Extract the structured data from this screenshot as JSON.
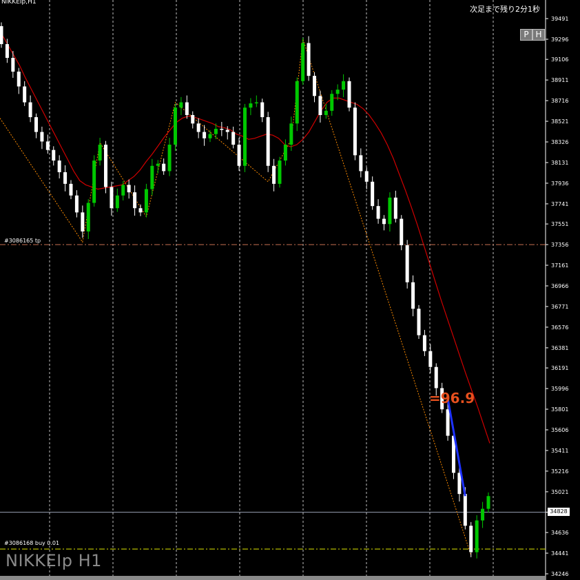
{
  "header": {
    "symbol_label": "NIKKEIp,H1",
    "countdown_text": "次足まで残り2分1秒",
    "p_button": "P",
    "h_button": "H"
  },
  "watermark": "NIKKEIp H1",
  "overlay_value": "=96.9",
  "orders": {
    "tp_label": "#3086165 tp",
    "buy_label": "#3086168 buy 0.01"
  },
  "current_price": "34828",
  "colors": {
    "background": "#000000",
    "bull_candle": "#00c800",
    "bear_candle": "#ffffff",
    "moving_average": "#d00000",
    "zigzag": "#ff8c00",
    "grid": "#c0c0c0",
    "tp_line": "#c87050",
    "buy_line": "#c8d000",
    "overlay_value": "#e6501e",
    "trade_line": "#1e32ff"
  },
  "chart_data": {
    "type": "candlestick",
    "y_ticks": [
      "39491",
      "39296",
      "39106",
      "38911",
      "38716",
      "38521",
      "38326",
      "38131",
      "37936",
      "37741",
      "37551",
      "37356",
      "37161",
      "36966",
      "36771",
      "36576",
      "36381",
      "36191",
      "35996",
      "35801",
      "35606",
      "35411",
      "35216",
      "35021",
      "34828",
      "34636",
      "34441",
      "34246"
    ],
    "y_range": [
      34246,
      39491
    ],
    "grid": true,
    "tp_price": 37356,
    "buy_price": 34480,
    "current_price": 34828,
    "closes": [
      39250,
      39120,
      38990,
      38850,
      38700,
      38560,
      38420,
      38330,
      38250,
      38150,
      38040,
      37930,
      37820,
      37660,
      37480,
      37750,
      38150,
      38300,
      37900,
      37700,
      37820,
      37920,
      37850,
      37700,
      37660,
      37880,
      38100,
      38120,
      38050,
      38300,
      38650,
      38700,
      38580,
      38500,
      38420,
      38360,
      38400,
      38450,
      38440,
      38420,
      38300,
      38100,
      38650,
      38690,
      38700,
      38560,
      38100,
      37930,
      38150,
      38300,
      38500,
      38900,
      39260,
      38950,
      38760,
      38580,
      38620,
      38780,
      38820,
      38900,
      38650,
      38200,
      38050,
      37950,
      37720,
      37600,
      37550,
      37800,
      37600,
      37350,
      37000,
      36750,
      36500,
      36350,
      36200,
      36000,
      35800,
      35550,
      35200,
      35000,
      34700,
      34450,
      34750,
      34860,
      34980
    ],
    "ma_values": [
      39350,
      39250,
      39150,
      39050,
      38930,
      38820,
      38710,
      38600,
      38490,
      38380,
      38270,
      38160,
      38050,
      37960,
      37920,
      37900,
      37880,
      37890,
      37900,
      37910,
      37920,
      37960,
      38000,
      38060,
      38140,
      38210,
      38290,
      38370,
      38440,
      38510,
      38550,
      38570,
      38560,
      38540,
      38520,
      38500,
      38470,
      38460,
      38440,
      38400,
      38380,
      38350,
      38360,
      38380,
      38400,
      38390,
      38360,
      38300,
      38280,
      38300,
      38350,
      38420,
      38520,
      38620,
      38700,
      38740,
      38740,
      38720,
      38700,
      38680,
      38640,
      38580,
      38500,
      38410,
      38300,
      38170,
      38020,
      37870,
      37710,
      37540,
      37360,
      37180,
      37000,
      36820,
      36650,
      36480,
      36310,
      36140,
      35980,
      35820,
      35650,
      35480
    ]
  }
}
